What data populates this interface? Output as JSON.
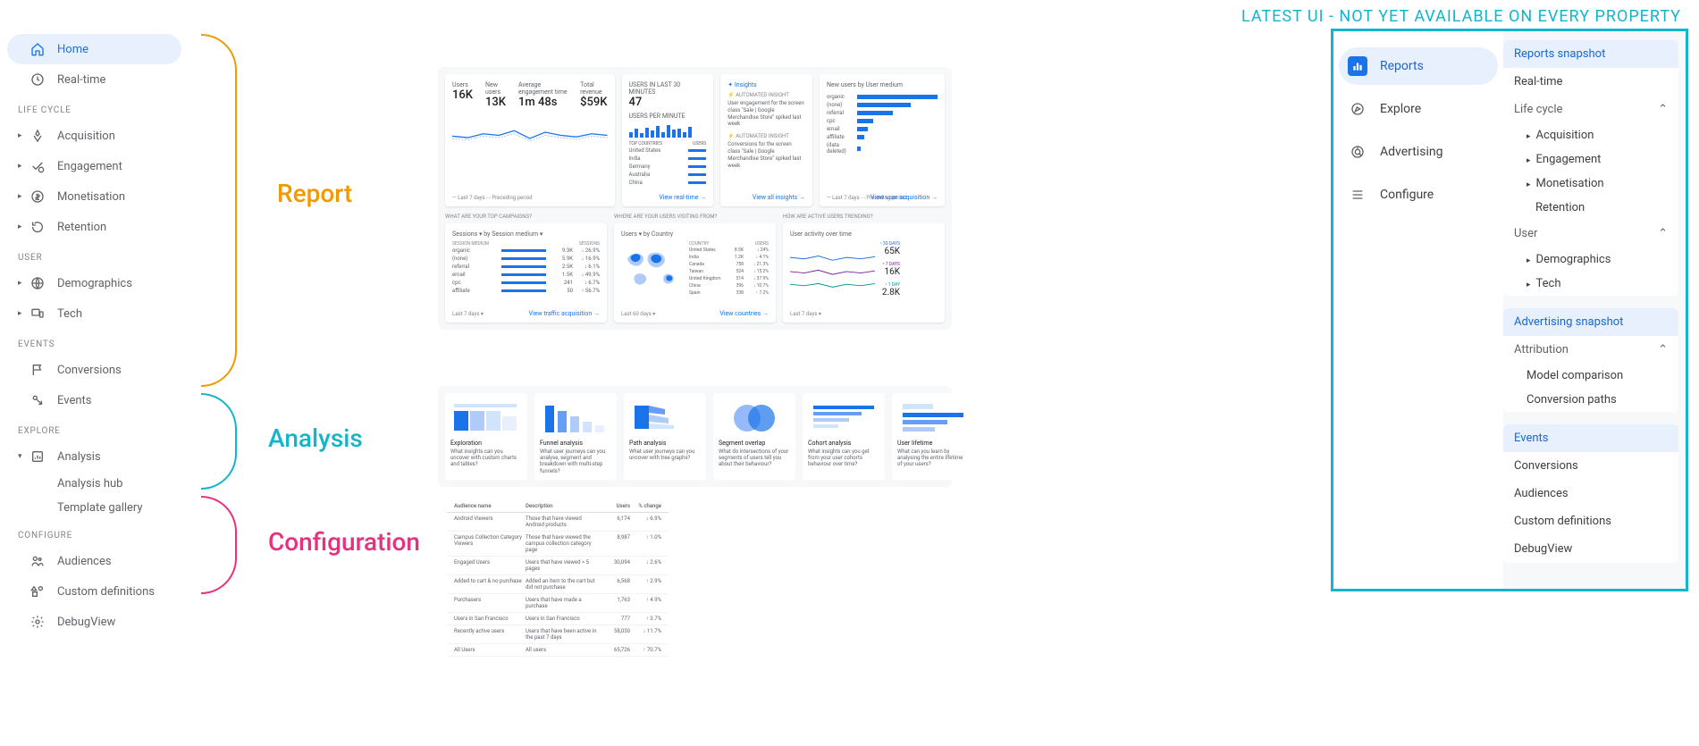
{
  "left_sidebar": {
    "home": "Home",
    "realtime": "Real-time",
    "sections": {
      "lifecycle": "LIFE CYCLE",
      "user": "USER",
      "events": "EVENTS",
      "explore": "EXPLORE",
      "configure": "CONFIGURE"
    },
    "lifecycle": [
      "Acquisition",
      "Engagement",
      "Monetisation",
      "Retention"
    ],
    "user": [
      "Demographics",
      "Tech"
    ],
    "events": [
      "Conversions",
      "Events"
    ],
    "explore": {
      "parent": "Analysis",
      "children": [
        "Analysis hub",
        "Template gallery"
      ]
    },
    "configure": [
      "Audiences",
      "Custom definitions",
      "DebugView"
    ]
  },
  "bracket_labels": {
    "report": "Report",
    "analysis": "Analysis",
    "configuration": "Configuration"
  },
  "report_preview": {
    "metrics": [
      {
        "label": "Users",
        "value": "16K"
      },
      {
        "label": "New users",
        "value": "13K"
      },
      {
        "label": "Average engagement time",
        "value": "1m 48s"
      },
      {
        "label": "Total revenue",
        "value": "$59K"
      }
    ],
    "realtime": {
      "title": "USERS IN LAST 30 MINUTES",
      "value": "47",
      "sub": "USERS PER MINUTE",
      "countries_label": "TOP COUNTRIES",
      "countries": [
        "United States",
        "India",
        "Germany",
        "Australia",
        "China"
      ],
      "link": "View real-time"
    },
    "insights": {
      "title": "Insights",
      "item1": "User engagement for the screen class \"Sale | Google Merchandise Store\" spiked last week",
      "item2": "Conversions for the screen class \"Sale | Google Merchandise Store\" spiked last week",
      "link": "View all insights"
    },
    "acquisition": {
      "title": "New users by User medium",
      "items": [
        "organic",
        "(none)",
        "referral",
        "cpc",
        "email",
        "affiliate",
        "(data deleted)"
      ],
      "link": "View user acquisition"
    },
    "row2_headers": {
      "campaigns": "WHAT ARE YOUR TOP CAMPAIGNS?",
      "visiting": "WHERE ARE YOUR USERS VISITING FROM?",
      "trending": "HOW ARE ACTIVE USERS TRENDING?"
    },
    "sessions": {
      "title": "Sessions ▾ by Session medium ▾",
      "header_left": "SESSION MEDIUM",
      "header_right": "SESSIONS",
      "rows": [
        {
          "name": "organic",
          "val": "9.3K",
          "pct": "↓ 26.9%"
        },
        {
          "name": "(none)",
          "val": "5.9K",
          "pct": "↓ 16.9%"
        },
        {
          "name": "referral",
          "val": "2.5K",
          "pct": "↓ 6.1%"
        },
        {
          "name": "email",
          "val": "1.5K",
          "pct": "↓ 49.9%"
        },
        {
          "name": "cpc",
          "val": "241",
          "pct": "↓ 6.7%"
        },
        {
          "name": "affiliate",
          "val": "50",
          "pct": "↑ 56.7%"
        }
      ],
      "footer": "Last 7 days ▾",
      "link": "View traffic acquisition"
    },
    "geo": {
      "title": "Users ▾ by Country",
      "header1": "COUNTRY",
      "header2": "USERS",
      "rows": [
        {
          "c": "United States",
          "u": "8.5K",
          "p": "↓ 24%"
        },
        {
          "c": "India",
          "u": "1.2K",
          "p": "↓ 4.1%"
        },
        {
          "c": "Canada",
          "u": "758",
          "p": "↓ 21.3%"
        },
        {
          "c": "Taiwan",
          "u": "524",
          "p": "↓ 15.2%"
        },
        {
          "c": "United Kingdom",
          "u": "514",
          "p": "↓ 37.9%"
        },
        {
          "c": "China",
          "u": "396",
          "p": "↓ 10.7%"
        },
        {
          "c": "Spain",
          "u": "338",
          "p": "↑ 7.2%"
        }
      ],
      "footer": "Last 60 days ▾",
      "link": "View countries"
    },
    "activity": {
      "title": "User activity over time",
      "stats": [
        {
          "label": "30 DAYS",
          "value": "65K"
        },
        {
          "label": "7 DAYS",
          "value": "16K"
        },
        {
          "label": "1 DAY",
          "value": "2.8K"
        }
      ],
      "footer": "Last 7 days ▾"
    }
  },
  "analysis_preview": [
    {
      "title": "Exploration",
      "desc": "What insights can you uncover with custom charts and tables?"
    },
    {
      "title": "Funnel analysis",
      "desc": "What user journeys can you analyse, segment and breakdown with multi-step funnels?"
    },
    {
      "title": "Path analysis",
      "desc": "What user journeys can you uncover with tree graphs?"
    },
    {
      "title": "Segment overlap",
      "desc": "What do intersections of your segments of users tell you about their behaviour?"
    },
    {
      "title": "Cohort analysis",
      "desc": "What insights can you get from your user cohorts behaviour over time?"
    },
    {
      "title": "User lifetime",
      "desc": "What can you learn by analysing the entire lifetime of your users?"
    }
  ],
  "config_preview": {
    "headers": [
      "Audience name",
      "Description",
      "Users",
      "% change"
    ],
    "rows": [
      {
        "name": "Android Viewers",
        "desc": "Those that have viewed Android products",
        "users": "6,174",
        "pct": "↓ 6.9%"
      },
      {
        "name": "Campus Collection Category Viewers",
        "desc": "Those that have viewed the campus collection category page",
        "users": "8,987",
        "pct": "↑ 1.0%"
      },
      {
        "name": "Engaged Users",
        "desc": "Users that have viewed > 5 pages",
        "users": "30,094",
        "pct": "↓ 2.6%"
      },
      {
        "name": "Added to cart & no purchase",
        "desc": "Added an item to the cart but did not purchase",
        "users": "6,568",
        "pct": "↑ 2.9%"
      },
      {
        "name": "Purchasers",
        "desc": "Users that have made a purchase",
        "users": "1,763",
        "pct": "↑ 4.9%"
      },
      {
        "name": "Users in San Francisco",
        "desc": "Users in San Francisco",
        "users": "777",
        "pct": "↑ 3.7%"
      },
      {
        "name": "Recently active users",
        "desc": "Users that have been active in the past 7 days",
        "users": "58,030",
        "pct": "↓ 11.7%"
      },
      {
        "name": "All Users",
        "desc": "All users",
        "users": "65,726",
        "pct": "↑ 70.7%"
      }
    ]
  },
  "right_banner": "LATEST UI - NOT YET AVAILABLE ON EVERY PROPERTY",
  "right_main": [
    "Reports",
    "Explore",
    "Advertising",
    "Configure"
  ],
  "right_sub": {
    "reports_head": "Reports snapshot",
    "realtime": "Real-time",
    "lifecycle_label": "Life cycle",
    "lifecycle": [
      "Acquisition",
      "Engagement",
      "Monetisation",
      "Retention"
    ],
    "user_label": "User",
    "user": [
      "Demographics",
      "Tech"
    ],
    "adv_head": "Advertising snapshot",
    "attribution_label": "Attribution",
    "attribution": [
      "Model comparison",
      "Conversion paths"
    ],
    "events_head": "Events",
    "events": [
      "Conversions",
      "Audiences",
      "Custom definitions",
      "DebugView"
    ]
  }
}
